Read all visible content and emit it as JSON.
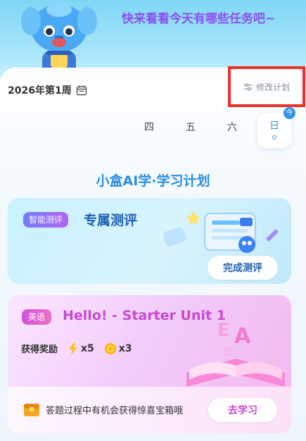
{
  "hero": {
    "message": "快来看看今天有哪些任务吧~"
  },
  "week": {
    "label": "2026年第1周",
    "edit_label": "修改计划"
  },
  "days": [
    {
      "label": "四",
      "selected": false
    },
    {
      "label": "五",
      "selected": false
    },
    {
      "label": "六",
      "selected": false
    },
    {
      "label": "日",
      "selected": true,
      "badge": "今"
    }
  ],
  "plan_title": "小盒AI学·学习计划",
  "assessment_card": {
    "tag": "智能测评",
    "title": "专属测评",
    "button": "完成测评"
  },
  "english_card": {
    "tag": "英语",
    "title": "Hello! - Starter Unit 1",
    "reward_label": "获得奖励",
    "rewards": [
      {
        "icon": "lightning-icon",
        "text": "x5"
      },
      {
        "icon": "coin-icon",
        "text": "x3"
      }
    ],
    "tip": "答题过程中有机会获得惊喜宝箱哦",
    "button": "去学习"
  },
  "colors": {
    "accent_blue": "#2f95e8",
    "accent_purple": "#8a4ff0",
    "english_pink": "#c64ad1",
    "highlight_red": "#e8322a"
  }
}
